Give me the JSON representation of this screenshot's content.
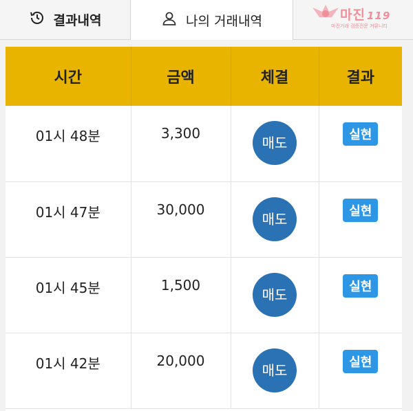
{
  "tabs": {
    "history_label": "결과내역",
    "my_label": "나의 거래내역"
  },
  "logo": {
    "name": "마진",
    "tag": "119",
    "subtitle": "마진거래 검증전문 커뮤니티"
  },
  "table": {
    "headers": [
      "시간",
      "금액",
      "체결",
      "결과"
    ],
    "rows": [
      {
        "time": "01시 48분",
        "amount": "3,300",
        "trade": "매도",
        "result": "실현"
      },
      {
        "time": "01시 47분",
        "amount": "30,000",
        "trade": "매도",
        "result": "실현"
      },
      {
        "time": "01시 45분",
        "amount": "1,500",
        "trade": "매도",
        "result": "실현"
      },
      {
        "time": "01시 42분",
        "amount": "20,000",
        "trade": "매도",
        "result": "실현"
      }
    ]
  },
  "colors": {
    "header_bg": "#e8b400",
    "sell_button": "#2a72b3",
    "result_badge": "#2d97e6"
  }
}
